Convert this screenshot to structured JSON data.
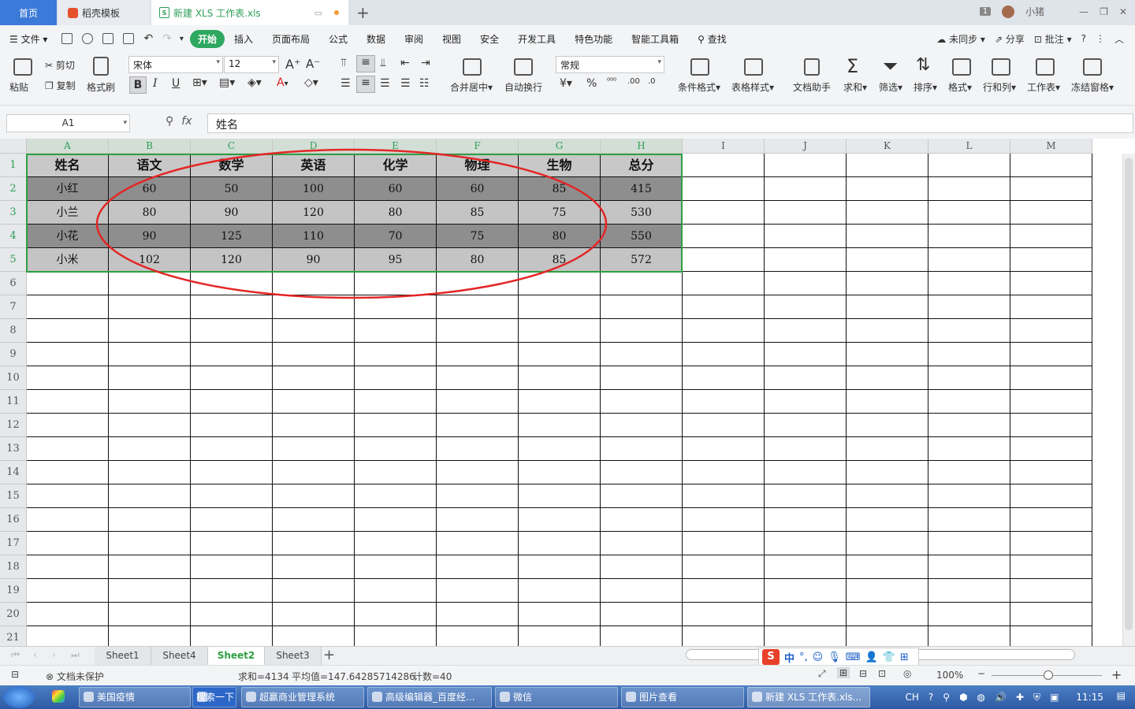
{
  "tabs": {
    "home": "首页",
    "docer": "稻壳模板",
    "file": "新建 XLS 工作表.xls"
  },
  "window": {
    "badge": "1",
    "user": "小猪"
  },
  "menu": {
    "file": "文件",
    "items": [
      "开始",
      "插入",
      "页面布局",
      "公式",
      "数据",
      "审阅",
      "视图",
      "安全",
      "开发工具",
      "特色功能",
      "智能工具箱"
    ],
    "search": "查找",
    "right": [
      "未同步",
      "分享",
      "批注"
    ]
  },
  "toolbar": {
    "paste": "粘贴",
    "cut": "剪切",
    "copy": "复制",
    "format_painter": "格式刷",
    "font": "宋体",
    "size": "12",
    "merge": "合并居中",
    "wrap": "自动换行",
    "number_format": "常规",
    "cond_format": "条件格式",
    "table_style": "表格样式",
    "doc_helper": "文档助手",
    "sum": "求和",
    "filter": "筛选",
    "sort": "排序",
    "format": "格式",
    "rowcol": "行和列",
    "sheet": "工作表",
    "freeze": "冻结窗格"
  },
  "formula": {
    "cell_ref": "A1",
    "fx": "fx",
    "value": "姓名"
  },
  "grid": {
    "columns": [
      "A",
      "B",
      "C",
      "D",
      "E",
      "F",
      "G",
      "H",
      "I",
      "J",
      "K",
      "L",
      "M"
    ],
    "rows": [
      "1",
      "2",
      "3",
      "4",
      "5",
      "6",
      "7",
      "8",
      "9",
      "10",
      "11",
      "12",
      "13",
      "14",
      "15",
      "16",
      "17",
      "18",
      "19",
      "20",
      "21"
    ],
    "header": [
      "姓名",
      "语文",
      "数学",
      "英语",
      "化学",
      "物理",
      "生物",
      "总分"
    ],
    "data": [
      [
        "小红",
        "60",
        "50",
        "100",
        "60",
        "60",
        "85",
        "415"
      ],
      [
        "小兰",
        "80",
        "90",
        "120",
        "80",
        "85",
        "75",
        "530"
      ],
      [
        "小花",
        "90",
        "125",
        "110",
        "70",
        "75",
        "80",
        "550"
      ],
      [
        "小米",
        "102",
        "120",
        "90",
        "95",
        "80",
        "85",
        "572"
      ]
    ]
  },
  "sheets": [
    "Sheet1",
    "Sheet4",
    "Sheet2",
    "Sheet3"
  ],
  "active_sheet": "Sheet2",
  "status": {
    "protect": "文档未保护",
    "sum": "求和=4134",
    "avg": "平均值=147.64285714286",
    "count": "计数=40",
    "zoom": "100%"
  },
  "taskbar": {
    "items": [
      "美国疫情",
      "搜索一下",
      "超赢商业管理系统",
      "高级编辑器_百度经...",
      "微信",
      "图片查看",
      "新建 XLS 工作表.xls..."
    ],
    "lang": "CH",
    "time": "11:15"
  },
  "ime": {
    "label": "中"
  },
  "colors": {
    "accent": "#2ea860",
    "selection": "#2ea043",
    "annotation": "#e32626"
  }
}
